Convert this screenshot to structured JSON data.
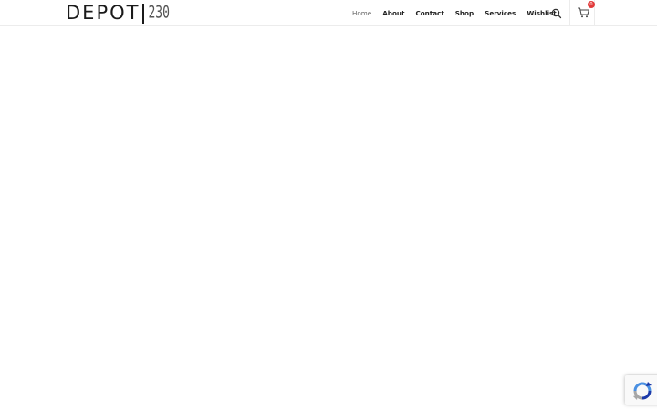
{
  "logo": {
    "main": "DEPOT",
    "number": "230"
  },
  "nav": {
    "items": [
      {
        "label": "Home",
        "active": true
      },
      {
        "label": "About",
        "active": false
      },
      {
        "label": "Contact",
        "active": false
      },
      {
        "label": "Shop",
        "active": false
      },
      {
        "label": "Services",
        "active": false
      },
      {
        "label": "Wishlist",
        "active": false
      }
    ]
  },
  "search": {
    "icon": "search-icon"
  },
  "cart": {
    "icon": "cart-icon",
    "count": "0"
  },
  "recaptcha": {
    "icon": "recaptcha-icon"
  },
  "colors": {
    "badge": "#e23b3b",
    "text": "#222222",
    "border": "#ececec"
  }
}
